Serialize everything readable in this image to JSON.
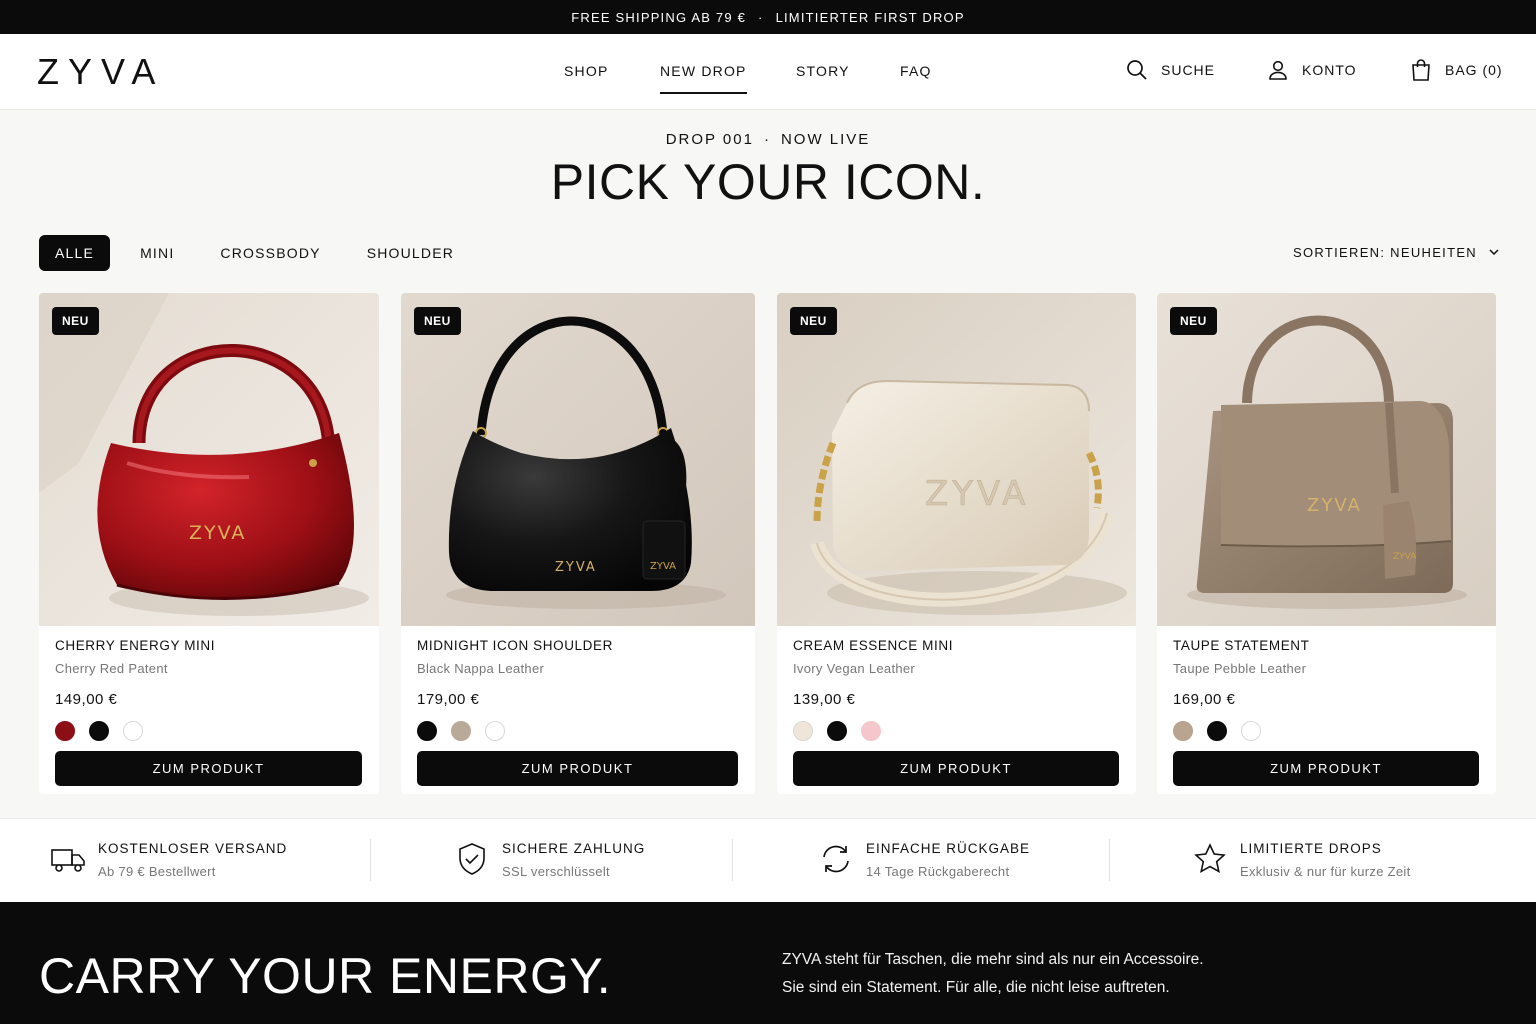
{
  "announcement": {
    "left": "FREE SHIPPING AB 79 €",
    "separator": "·",
    "right": "LIMITIERTER FIRST DROP"
  },
  "header": {
    "logo": "ZYVA",
    "nav": [
      "SHOP",
      "NEW DROP",
      "STORY",
      "FAQ"
    ],
    "active_nav": "NEW DROP",
    "search_label": "SUCHE",
    "account_label": "KONTO",
    "bag_label": "BAG (0)"
  },
  "hero": {
    "eyebrow_left": "DROP 001",
    "eyebrow_sep": "·",
    "eyebrow_right": "NOW LIVE",
    "title": "PICK YOUR ICON."
  },
  "filters": {
    "chips": [
      "ALLE",
      "MINI",
      "CROSSBODY",
      "SHOULDER"
    ],
    "active": "ALLE",
    "sort_label": "SORTIEREN: NEUHEITEN"
  },
  "products": [
    {
      "badge": "NEU",
      "name": "CHERRY ENERGY MINI",
      "material": "Cherry Red Patent",
      "price": "149,00 €",
      "brand_mark": "ZYVA",
      "swatches": [
        "#8b0f14",
        "#0b0b0b",
        "#ffffff"
      ],
      "cta": "ZUM PRODUKT"
    },
    {
      "badge": "NEU",
      "name": "MIDNIGHT ICON SHOULDER",
      "material": "Black Nappa Leather",
      "price": "179,00 €",
      "brand_mark": "ZYVA",
      "swatches": [
        "#0b0b0b",
        "#b9a999",
        "#ffffff"
      ],
      "cta": "ZUM PRODUKT"
    },
    {
      "badge": "NEU",
      "name": "CREAM ESSENCE MINI",
      "material": "Ivory Vegan Leather",
      "price": "139,00 €",
      "brand_mark": "ZYVA",
      "swatches": [
        "#efe6d9",
        "#0b0b0b",
        "#f6c6cd"
      ],
      "cta": "ZUM PRODUKT"
    },
    {
      "badge": "NEU",
      "name": "TAUPE STATEMENT",
      "material": "Taupe Pebble Leather",
      "price": "169,00 €",
      "brand_mark": "ZYVA",
      "swatches": [
        "#b8a48f",
        "#0b0b0b",
        "#ffffff"
      ],
      "cta": "ZUM PRODUKT"
    }
  ],
  "features": [
    {
      "icon": "truck-icon",
      "title": "KOSTENLOSER VERSAND",
      "sub": "Ab 79 € Bestellwert"
    },
    {
      "icon": "shield-check-icon",
      "title": "SICHERE ZAHLUNG",
      "sub": "SSL verschlüsselt"
    },
    {
      "icon": "refresh-icon",
      "title": "EINFACHE RÜCKGABE",
      "sub": "14 Tage Rückgaberecht"
    },
    {
      "icon": "star-icon",
      "title": "LIMITIERTE DROPS",
      "sub": "Exklusiv & nur für kurze Zeit"
    }
  ],
  "footer": {
    "title": "CARRY YOUR ENERGY.",
    "line1": "ZYVA steht für Taschen, die mehr sind als nur ein Accessoire.",
    "line2": "Sie sind ein Statement. Für alle, die nicht leise auftreten."
  },
  "colors": {
    "black": "#0b0b0b",
    "page_bg": "#f7f7f6",
    "muted_text": "#777777"
  }
}
